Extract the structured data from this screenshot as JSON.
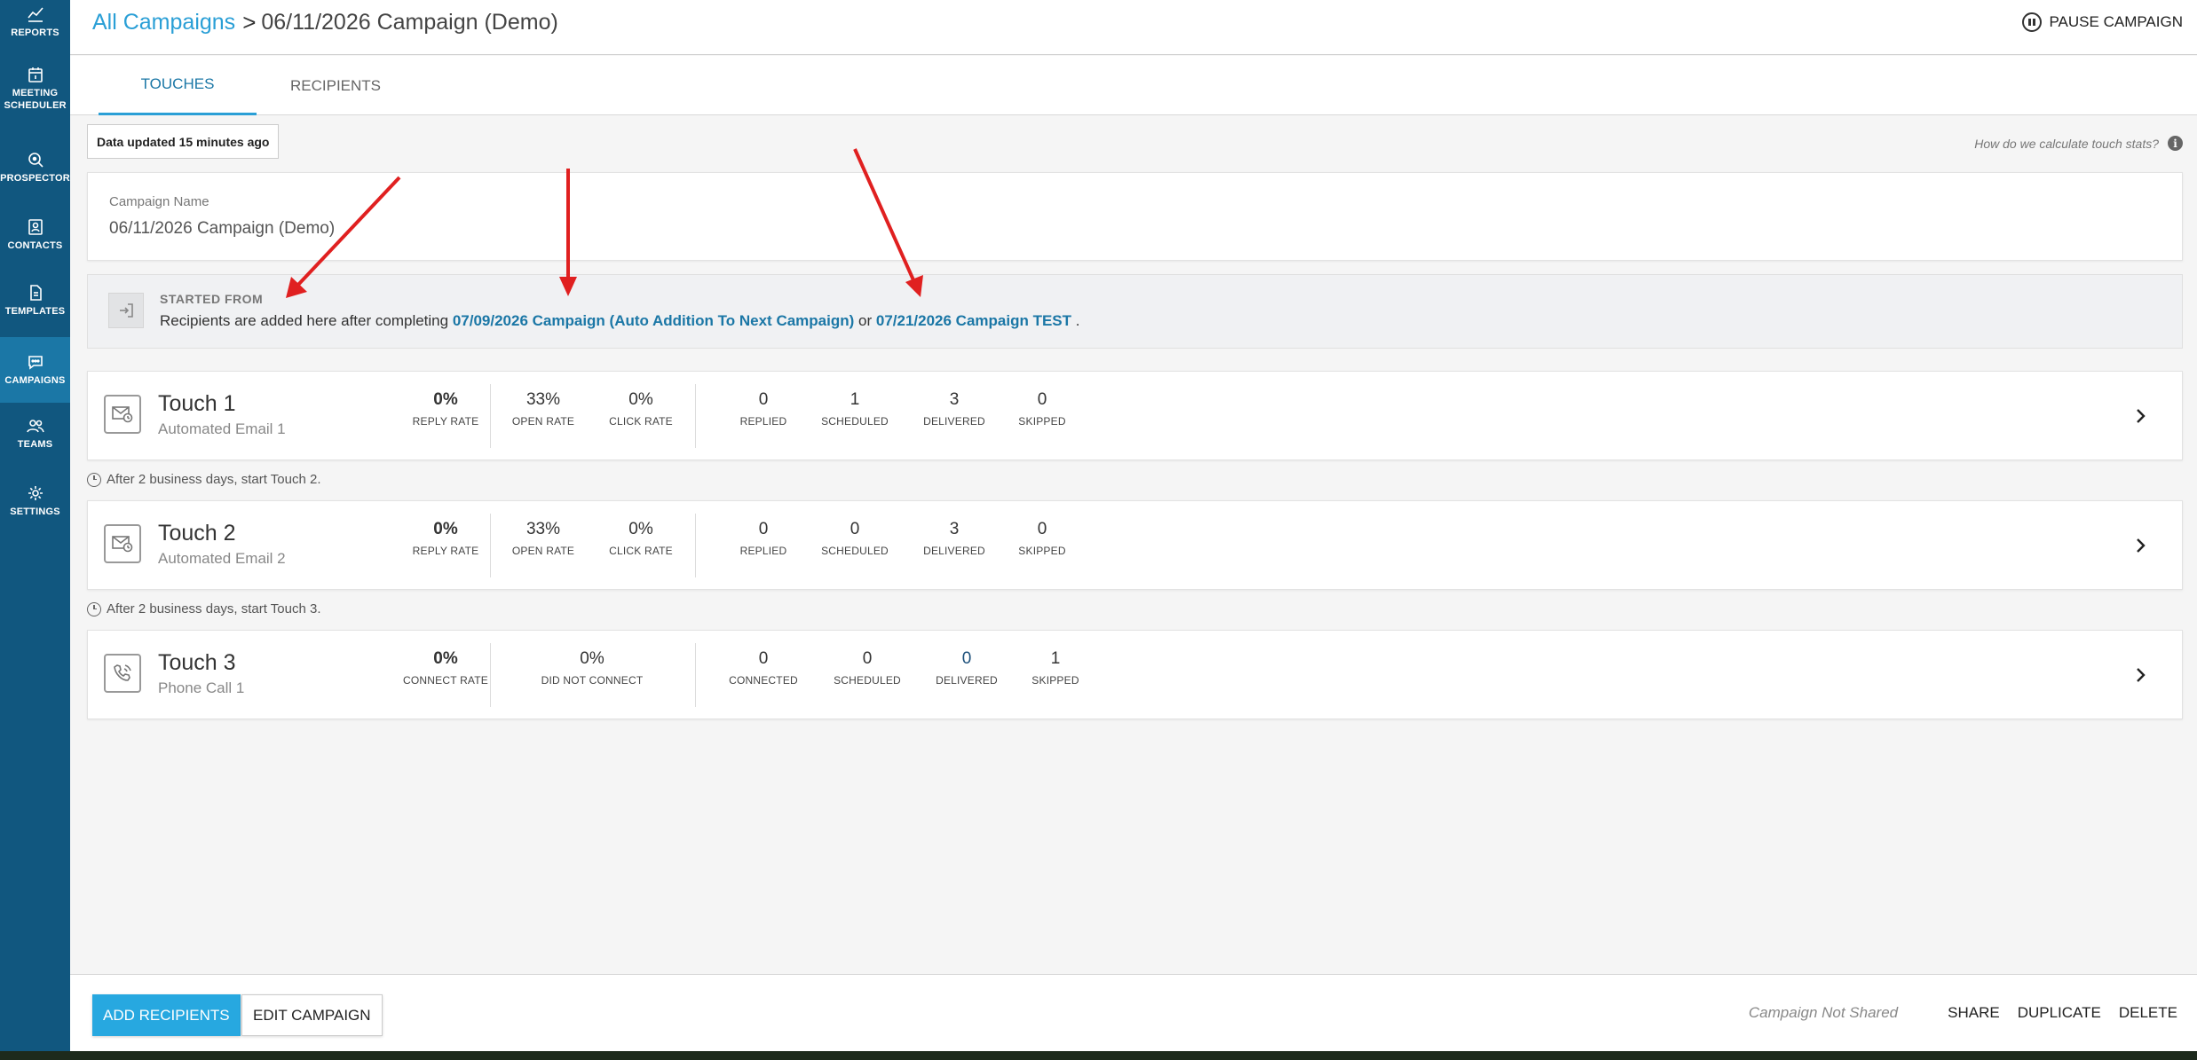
{
  "sidebar": {
    "items": [
      {
        "label": "REPORTS",
        "icon": "reports-icon"
      },
      {
        "label": "MEETING SCHEDULER",
        "icon": "calendar-icon"
      },
      {
        "label": "PROSPECTOR",
        "icon": "search-icon"
      },
      {
        "label": "CONTACTS",
        "icon": "contact-card-icon"
      },
      {
        "label": "TEMPLATES",
        "icon": "document-icon"
      },
      {
        "label": "CAMPAIGNS",
        "icon": "chat-icon",
        "active": true
      },
      {
        "label": "TEAMS",
        "icon": "people-icon"
      },
      {
        "label": "SETTINGS",
        "icon": "gear-icon"
      }
    ]
  },
  "header": {
    "breadcrumb_link": "All Campaigns",
    "breadcrumb_separator": ">",
    "campaign_title": "06/11/2026 Campaign (Demo)",
    "pause_label": "PAUSE CAMPAIGN"
  },
  "tabs": [
    {
      "label": "TOUCHES",
      "active": true
    },
    {
      "label": "RECIPIENTS",
      "active": false
    }
  ],
  "data_updated": "Data updated 15 minutes ago",
  "calc_link": "How do we calculate touch stats?",
  "campaign_name": {
    "label": "Campaign Name",
    "value": "06/11/2026 Campaign (Demo)"
  },
  "started_from": {
    "title": "STARTED FROM",
    "text_before": "Recipients are added here after completing",
    "link1": "07/09/2026 Campaign (Auto Addition To Next Campaign)",
    "text_mid": "or",
    "link2": "07/21/2026 Campaign TEST",
    "text_after": "."
  },
  "touches": [
    {
      "title": "Touch 1",
      "subtitle": "Automated Email 1",
      "type": "email",
      "rate1": {
        "value": "0%",
        "label": "REPLY RATE"
      },
      "rate2": {
        "value": "33%",
        "label": "OPEN RATE"
      },
      "rate3": {
        "value": "0%",
        "label": "CLICK RATE"
      },
      "counts": [
        {
          "value": "0",
          "label": "REPLIED"
        },
        {
          "value": "1",
          "label": "SCHEDULED"
        },
        {
          "value": "3",
          "label": "DELIVERED"
        },
        {
          "value": "0",
          "label": "SKIPPED"
        }
      ]
    },
    {
      "title": "Touch 2",
      "subtitle": "Automated Email 2",
      "type": "email",
      "rate1": {
        "value": "0%",
        "label": "REPLY RATE"
      },
      "rate2": {
        "value": "33%",
        "label": "OPEN RATE"
      },
      "rate3": {
        "value": "0%",
        "label": "CLICK RATE"
      },
      "counts": [
        {
          "value": "0",
          "label": "REPLIED"
        },
        {
          "value": "0",
          "label": "SCHEDULED"
        },
        {
          "value": "3",
          "label": "DELIVERED"
        },
        {
          "value": "0",
          "label": "SKIPPED"
        }
      ]
    },
    {
      "title": "Touch 3",
      "subtitle": "Phone Call 1",
      "type": "phone",
      "rate1": {
        "value": "0%",
        "label": "CONNECT RATE"
      },
      "rate2": {
        "value": "0%",
        "label": "DID NOT CONNECT"
      },
      "counts": [
        {
          "value": "0",
          "label": "CONNECTED"
        },
        {
          "value": "0",
          "label": "SCHEDULED"
        },
        {
          "value": "0",
          "label": "DELIVERED"
        },
        {
          "value": "1",
          "label": "SKIPPED"
        }
      ]
    }
  ],
  "delays": [
    "After 2 business days, start Touch 2.",
    "After 2 business days, start Touch 3."
  ],
  "footer": {
    "add_recipients": "ADD RECIPIENTS",
    "edit_campaign": "EDIT CAMPAIGN",
    "not_shared": "Campaign Not Shared",
    "share": "SHARE",
    "duplicate": "DUPLICATE",
    "delete": "DELETE"
  },
  "colors": {
    "sidebar": "#11577f",
    "sidebar_active": "#1b77a6",
    "accent": "#2a9fd6",
    "link": "#1b77a6",
    "primary_button": "#27a8e0",
    "annotation_arrow": "#e02020"
  }
}
